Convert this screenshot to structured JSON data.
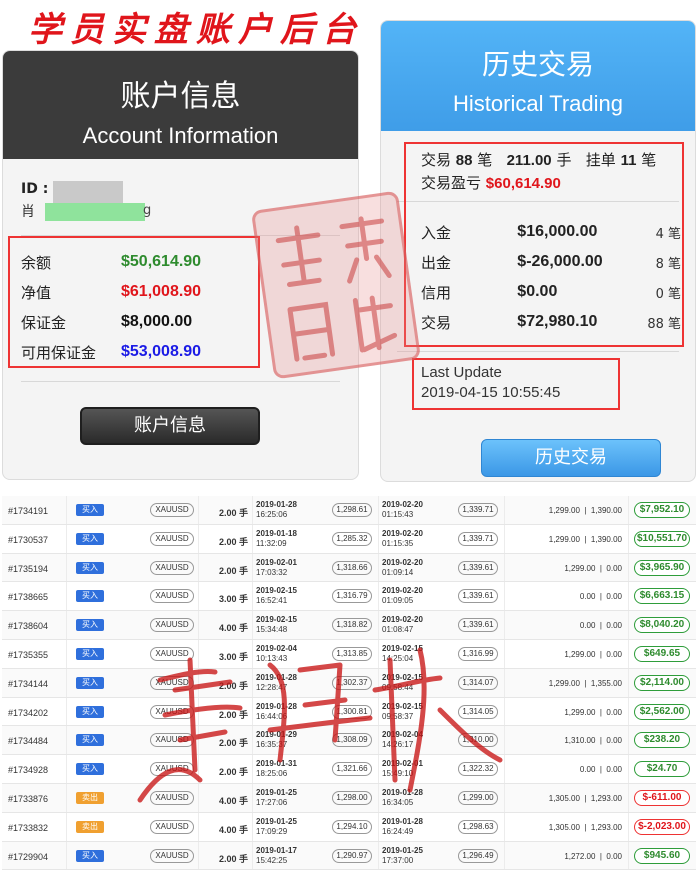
{
  "banner": {
    "title": "学员实盘账户后台"
  },
  "account": {
    "title_zh": "账户信息",
    "title_en": "Account Information",
    "id_label": "ID :",
    "name_prefix": "肖",
    "name_suffix": "g",
    "rows": [
      {
        "label": "余额",
        "value": "$50,614.90",
        "color": "#2e8b2e"
      },
      {
        "label": "净值",
        "value": "$61,008.90",
        "color": "#e0151b"
      },
      {
        "label": "保证金",
        "value": "$8,000.00",
        "color": "#111111"
      },
      {
        "label": "可用保证金",
        "value": "$53,008.90",
        "color": "#1a1ae6"
      }
    ],
    "button": "账户信息"
  },
  "history": {
    "title_zh": "历史交易",
    "title_en": "Historical Trading",
    "summary": {
      "trades_label": "交易",
      "trades_count": "88",
      "unit_bi": "笔",
      "lots": "211.00",
      "unit_shou": "手",
      "pending_label": "挂单",
      "pending_count": "11",
      "pl_label": "交易盈亏",
      "pl_value": "$60,614.90"
    },
    "rows": [
      {
        "label": "入金",
        "amount": "$16,000.00",
        "count": "4 笔"
      },
      {
        "label": "出金",
        "amount": "$-26,000.00",
        "count": "8 笔"
      },
      {
        "label": "信用",
        "amount": "$0.00",
        "count": "0 笔"
      },
      {
        "label": "交易",
        "amount": "$72,980.10",
        "count": "88 笔"
      }
    ],
    "last_update_label": "Last Update",
    "last_update_value": "2019-04-15 10:55:45",
    "button": "历史交易"
  },
  "trades": [
    {
      "id": "#1734191",
      "dir": "买入",
      "type": "buy",
      "symbol": "XAUUSD",
      "lots": "2.00 手",
      "open_date": "2019-01-28",
      "open_time": "16:25:06",
      "open_price": "1,298.61",
      "close_date": "2019-02-20",
      "close_time": "01:15:43",
      "close_price": "1,339.71",
      "sl": "1,299.00",
      "tp": "1,390.00",
      "pl": "$7,952.10",
      "pl_sign": "pos"
    },
    {
      "id": "#1730537",
      "dir": "买入",
      "type": "buy",
      "symbol": "XAUUSD",
      "lots": "2.00 手",
      "open_date": "2019-01-18",
      "open_time": "11:32:09",
      "open_price": "1,285.32",
      "close_date": "2019-02-20",
      "close_time": "01:15:35",
      "close_price": "1,339.71",
      "sl": "1,299.00",
      "tp": "1,390.00",
      "pl": "$10,551.70",
      "pl_sign": "pos"
    },
    {
      "id": "#1735194",
      "dir": "买入",
      "type": "buy",
      "symbol": "XAUUSD",
      "lots": "2.00 手",
      "open_date": "2019-02-01",
      "open_time": "17:03:32",
      "open_price": "1,318.66",
      "close_date": "2019-02-20",
      "close_time": "01:09:14",
      "close_price": "1,339.61",
      "sl": "1,299.00",
      "tp": "0.00",
      "pl": "$3,965.90",
      "pl_sign": "pos"
    },
    {
      "id": "#1738665",
      "dir": "买入",
      "type": "buy",
      "symbol": "XAUUSD",
      "lots": "3.00 手",
      "open_date": "2019-02-15",
      "open_time": "16:52:41",
      "open_price": "1,316.79",
      "close_date": "2019-02-20",
      "close_time": "01:09:05",
      "close_price": "1,339.61",
      "sl": "0.00",
      "tp": "0.00",
      "pl": "$6,663.15",
      "pl_sign": "pos"
    },
    {
      "id": "#1738604",
      "dir": "买入",
      "type": "buy",
      "symbol": "XAUUSD",
      "lots": "4.00 手",
      "open_date": "2019-02-15",
      "open_time": "15:34:48",
      "open_price": "1,318.82",
      "close_date": "2019-02-20",
      "close_time": "01:08:47",
      "close_price": "1,339.61",
      "sl": "0.00",
      "tp": "0.00",
      "pl": "$8,040.20",
      "pl_sign": "pos"
    },
    {
      "id": "#1735355",
      "dir": "买入",
      "type": "buy",
      "symbol": "XAUUSD",
      "lots": "3.00 手",
      "open_date": "2019-02-04",
      "open_time": "10:13:43",
      "open_price": "1,313.85",
      "close_date": "2019-02-15",
      "close_time": "14:25:04",
      "close_price": "1,316.99",
      "sl": "1,299.00",
      "tp": "0.00",
      "pl": "$649.65",
      "pl_sign": "pos"
    },
    {
      "id": "#1734144",
      "dir": "买入",
      "type": "buy",
      "symbol": "XAUUSD",
      "lots": "2.00 手",
      "open_date": "2019-01-28",
      "open_time": "12:28:47",
      "open_price": "1,302.37",
      "close_date": "2019-02-15",
      "close_time": "09:58:44",
      "close_price": "1,314.07",
      "sl": "1,299.00",
      "tp": "1,355.00",
      "pl": "$2,114.00",
      "pl_sign": "pos"
    },
    {
      "id": "#1734202",
      "dir": "买入",
      "type": "buy",
      "symbol": "XAUUSD",
      "lots": "2.00 手",
      "open_date": "2019-01-28",
      "open_time": "16:44:06",
      "open_price": "1,300.81",
      "close_date": "2019-02-15",
      "close_time": "09:58:37",
      "close_price": "1,314.05",
      "sl": "1,299.00",
      "tp": "0.00",
      "pl": "$2,562.00",
      "pl_sign": "pos"
    },
    {
      "id": "#1734484",
      "dir": "买入",
      "type": "buy",
      "symbol": "XAUUSD",
      "lots": "2.00 手",
      "open_date": "2019-01-29",
      "open_time": "16:35:37",
      "open_price": "1,308.09",
      "close_date": "2019-02-04",
      "close_time": "14:26:17",
      "close_price": "1,310.00",
      "sl": "1,310.00",
      "tp": "0.00",
      "pl": "$238.20",
      "pl_sign": "pos"
    },
    {
      "id": "#1734928",
      "dir": "买入",
      "type": "buy",
      "symbol": "XAUUSD",
      "lots": "2.00 手",
      "open_date": "2019-01-31",
      "open_time": "18:25:06",
      "open_price": "1,321.66",
      "close_date": "2019-02-01",
      "close_time": "15:49:10",
      "close_price": "1,322.32",
      "sl": "0.00",
      "tp": "0.00",
      "pl": "$24.70",
      "pl_sign": "pos"
    },
    {
      "id": "#1733876",
      "dir": "卖出",
      "type": "sell",
      "symbol": "XAUUSD",
      "lots": "4.00 手",
      "open_date": "2019-01-25",
      "open_time": "17:27:06",
      "open_price": "1,298.00",
      "close_date": "2019-01-28",
      "close_time": "16:34:05",
      "close_price": "1,299.00",
      "sl": "1,305.00",
      "tp": "1,293.00",
      "pl": "$-611.00",
      "pl_sign": "neg"
    },
    {
      "id": "#1733832",
      "dir": "卖出",
      "type": "sell",
      "symbol": "XAUUSD",
      "lots": "4.00 手",
      "open_date": "2019-01-25",
      "open_time": "17:09:29",
      "open_price": "1,294.10",
      "close_date": "2019-01-28",
      "close_time": "16:24:49",
      "close_price": "1,298.63",
      "sl": "1,305.00",
      "tp": "1,293.00",
      "pl": "$-2,023.00",
      "pl_sign": "neg"
    },
    {
      "id": "#1729904",
      "dir": "买入",
      "type": "buy",
      "symbol": "XAUUSD",
      "lots": "2.00 手",
      "open_date": "2019-01-17",
      "open_time": "15:42:25",
      "open_price": "1,290.97",
      "close_date": "2019-01-25",
      "close_time": "17:37:00",
      "close_price": "1,296.49",
      "sl": "1,272.00",
      "tp": "0.00",
      "pl": "$945.60",
      "pl_sign": "pos"
    }
  ],
  "colors": {
    "buy_badge": "#2f6fdc",
    "sell_badge": "#f0a030",
    "profit": "#2e8b2e",
    "loss": "#e0151b",
    "accent_blue": "#3f9de8",
    "dark_header": "#3b3b3b"
  }
}
